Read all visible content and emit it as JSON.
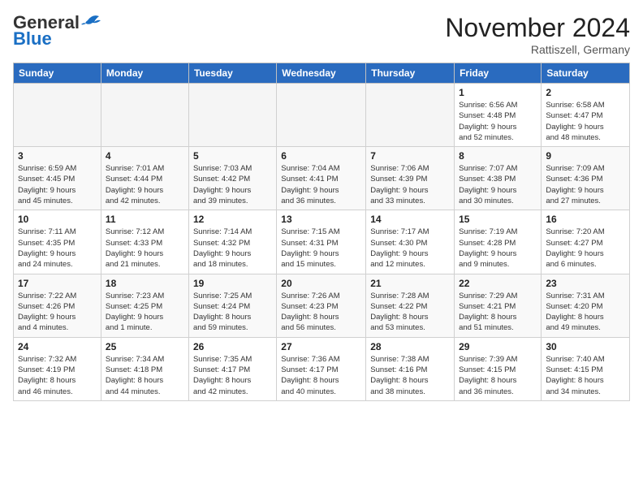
{
  "header": {
    "logo_general": "General",
    "logo_blue": "Blue",
    "month_title": "November 2024",
    "location": "Rattiszell, Germany"
  },
  "days_of_week": [
    "Sunday",
    "Monday",
    "Tuesday",
    "Wednesday",
    "Thursday",
    "Friday",
    "Saturday"
  ],
  "weeks": [
    [
      {
        "day": null,
        "info": ""
      },
      {
        "day": null,
        "info": ""
      },
      {
        "day": null,
        "info": ""
      },
      {
        "day": null,
        "info": ""
      },
      {
        "day": null,
        "info": ""
      },
      {
        "day": "1",
        "info": "Sunrise: 6:56 AM\nSunset: 4:48 PM\nDaylight: 9 hours\nand 52 minutes."
      },
      {
        "day": "2",
        "info": "Sunrise: 6:58 AM\nSunset: 4:47 PM\nDaylight: 9 hours\nand 48 minutes."
      }
    ],
    [
      {
        "day": "3",
        "info": "Sunrise: 6:59 AM\nSunset: 4:45 PM\nDaylight: 9 hours\nand 45 minutes."
      },
      {
        "day": "4",
        "info": "Sunrise: 7:01 AM\nSunset: 4:44 PM\nDaylight: 9 hours\nand 42 minutes."
      },
      {
        "day": "5",
        "info": "Sunrise: 7:03 AM\nSunset: 4:42 PM\nDaylight: 9 hours\nand 39 minutes."
      },
      {
        "day": "6",
        "info": "Sunrise: 7:04 AM\nSunset: 4:41 PM\nDaylight: 9 hours\nand 36 minutes."
      },
      {
        "day": "7",
        "info": "Sunrise: 7:06 AM\nSunset: 4:39 PM\nDaylight: 9 hours\nand 33 minutes."
      },
      {
        "day": "8",
        "info": "Sunrise: 7:07 AM\nSunset: 4:38 PM\nDaylight: 9 hours\nand 30 minutes."
      },
      {
        "day": "9",
        "info": "Sunrise: 7:09 AM\nSunset: 4:36 PM\nDaylight: 9 hours\nand 27 minutes."
      }
    ],
    [
      {
        "day": "10",
        "info": "Sunrise: 7:11 AM\nSunset: 4:35 PM\nDaylight: 9 hours\nand 24 minutes."
      },
      {
        "day": "11",
        "info": "Sunrise: 7:12 AM\nSunset: 4:33 PM\nDaylight: 9 hours\nand 21 minutes."
      },
      {
        "day": "12",
        "info": "Sunrise: 7:14 AM\nSunset: 4:32 PM\nDaylight: 9 hours\nand 18 minutes."
      },
      {
        "day": "13",
        "info": "Sunrise: 7:15 AM\nSunset: 4:31 PM\nDaylight: 9 hours\nand 15 minutes."
      },
      {
        "day": "14",
        "info": "Sunrise: 7:17 AM\nSunset: 4:30 PM\nDaylight: 9 hours\nand 12 minutes."
      },
      {
        "day": "15",
        "info": "Sunrise: 7:19 AM\nSunset: 4:28 PM\nDaylight: 9 hours\nand 9 minutes."
      },
      {
        "day": "16",
        "info": "Sunrise: 7:20 AM\nSunset: 4:27 PM\nDaylight: 9 hours\nand 6 minutes."
      }
    ],
    [
      {
        "day": "17",
        "info": "Sunrise: 7:22 AM\nSunset: 4:26 PM\nDaylight: 9 hours\nand 4 minutes."
      },
      {
        "day": "18",
        "info": "Sunrise: 7:23 AM\nSunset: 4:25 PM\nDaylight: 9 hours\nand 1 minute."
      },
      {
        "day": "19",
        "info": "Sunrise: 7:25 AM\nSunset: 4:24 PM\nDaylight: 8 hours\nand 59 minutes."
      },
      {
        "day": "20",
        "info": "Sunrise: 7:26 AM\nSunset: 4:23 PM\nDaylight: 8 hours\nand 56 minutes."
      },
      {
        "day": "21",
        "info": "Sunrise: 7:28 AM\nSunset: 4:22 PM\nDaylight: 8 hours\nand 53 minutes."
      },
      {
        "day": "22",
        "info": "Sunrise: 7:29 AM\nSunset: 4:21 PM\nDaylight: 8 hours\nand 51 minutes."
      },
      {
        "day": "23",
        "info": "Sunrise: 7:31 AM\nSunset: 4:20 PM\nDaylight: 8 hours\nand 49 minutes."
      }
    ],
    [
      {
        "day": "24",
        "info": "Sunrise: 7:32 AM\nSunset: 4:19 PM\nDaylight: 8 hours\nand 46 minutes."
      },
      {
        "day": "25",
        "info": "Sunrise: 7:34 AM\nSunset: 4:18 PM\nDaylight: 8 hours\nand 44 minutes."
      },
      {
        "day": "26",
        "info": "Sunrise: 7:35 AM\nSunset: 4:17 PM\nDaylight: 8 hours\nand 42 minutes."
      },
      {
        "day": "27",
        "info": "Sunrise: 7:36 AM\nSunset: 4:17 PM\nDaylight: 8 hours\nand 40 minutes."
      },
      {
        "day": "28",
        "info": "Sunrise: 7:38 AM\nSunset: 4:16 PM\nDaylight: 8 hours\nand 38 minutes."
      },
      {
        "day": "29",
        "info": "Sunrise: 7:39 AM\nSunset: 4:15 PM\nDaylight: 8 hours\nand 36 minutes."
      },
      {
        "day": "30",
        "info": "Sunrise: 7:40 AM\nSunset: 4:15 PM\nDaylight: 8 hours\nand 34 minutes."
      }
    ]
  ]
}
